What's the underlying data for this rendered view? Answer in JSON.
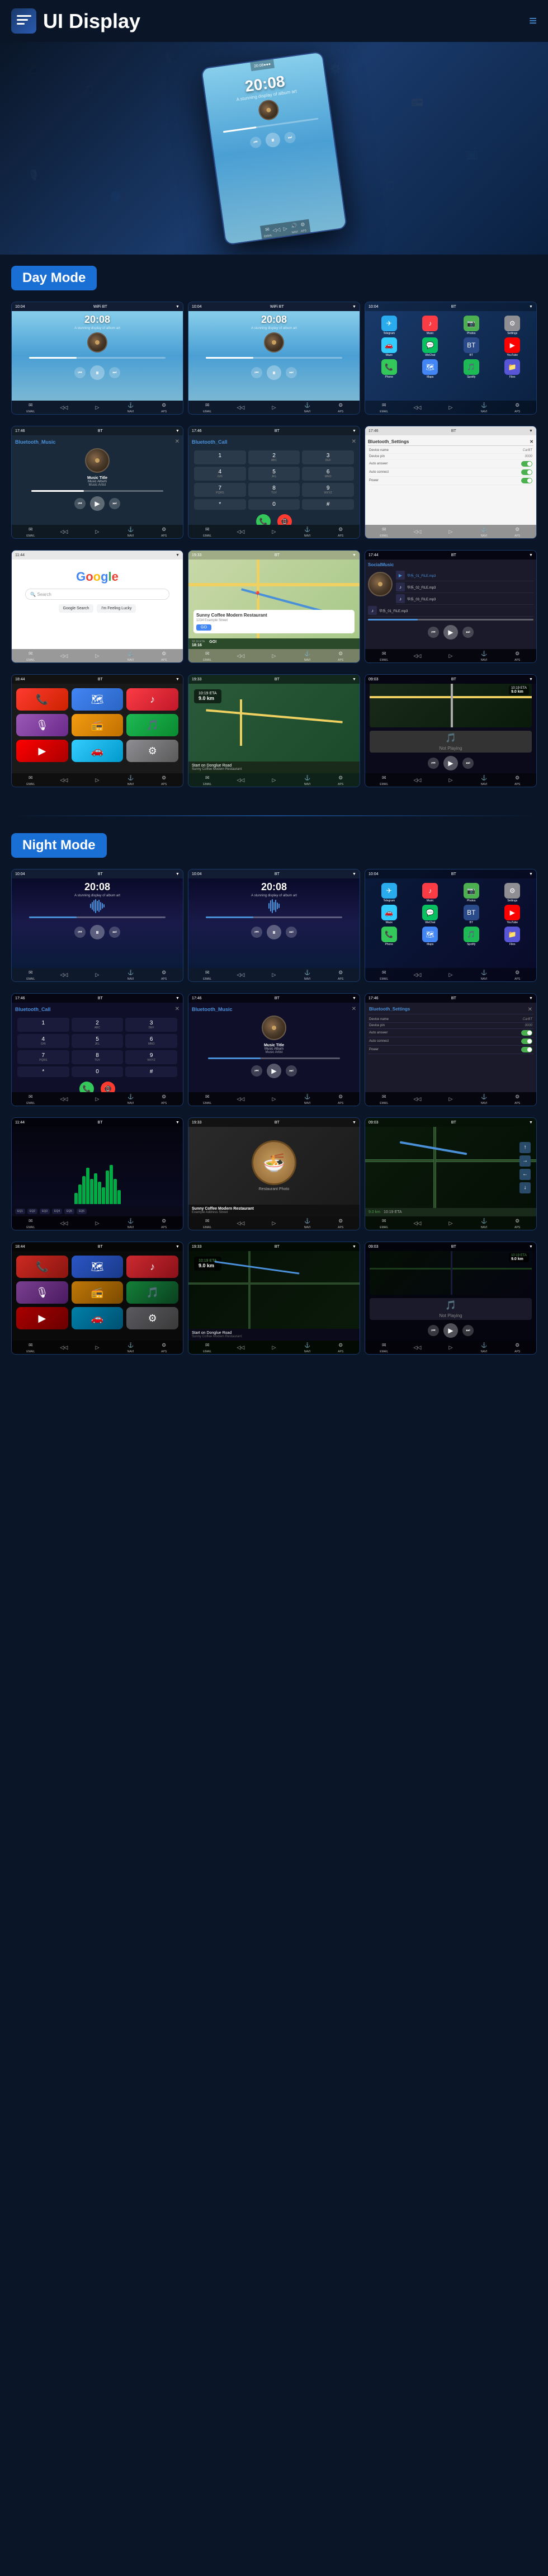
{
  "header": {
    "title": "UI Display",
    "menu_icon": "☰",
    "nav_icon": "≡"
  },
  "hero": {
    "time": "20:08",
    "subtitle": "A stunning display of album art"
  },
  "day_mode": {
    "label": "Day Mode",
    "screens": [
      {
        "type": "music_player",
        "theme": "day",
        "time": "20:08",
        "subtitle": "A stunning display of album art"
      },
      {
        "type": "music_player",
        "theme": "day",
        "time": "20:08",
        "subtitle": "A stunning display of album art"
      },
      {
        "type": "app_grid",
        "theme": "day"
      },
      {
        "type": "bluetooth_music",
        "title": "Bluetooth_Music",
        "track_title": "Music Title",
        "track_album": "Music Album",
        "track_artist": "Music Artist"
      },
      {
        "type": "bluetooth_call",
        "title": "Bluetooth_Call"
      },
      {
        "type": "bluetooth_settings",
        "title": "Bluetooth_Settings",
        "fields": [
          {
            "name": "Device name",
            "value": "CarBT"
          },
          {
            "name": "Device pin",
            "value": "0000"
          },
          {
            "name": "Auto answer",
            "value": "toggle_on"
          },
          {
            "name": "Auto connect",
            "value": "toggle_on"
          },
          {
            "name": "Power",
            "value": "toggle_on"
          }
        ]
      },
      {
        "type": "google",
        "search_placeholder": "Search"
      },
      {
        "type": "map_navigation",
        "destination": "Sunny Coffee Modern Restaurant",
        "address": "1234 Example Street"
      },
      {
        "type": "local_music",
        "title": "SocialMusic",
        "tracks": [
          {
            "name": "华乐_01_FILE.mp3",
            "active": true
          },
          {
            "name": "华乐_02_FILE.mp3",
            "active": false
          },
          {
            "name": "华乐_03_FILE.mp3",
            "active": false
          },
          {
            "name": "华乐_01_FILE.mp3",
            "active": false
          }
        ]
      },
      {
        "type": "carplay_apps",
        "apps": [
          "📞",
          "🗺️",
          "♪",
          "📱",
          "📻",
          "🎵",
          "📺",
          "🎙️",
          "⚙️"
        ]
      },
      {
        "type": "nav_detail",
        "eta": "10:19 ETA",
        "distance": "9.0 km",
        "instruction": "Start on Donglue Road",
        "poi_name": "Sunny Coffee Modern Restaurant"
      },
      {
        "type": "not_playing",
        "label": "Not Playing"
      }
    ]
  },
  "night_mode": {
    "label": "Night Mode",
    "screens": [
      {
        "type": "music_player",
        "theme": "night",
        "time": "20:08",
        "subtitle": "A stunning display of album art"
      },
      {
        "type": "music_player",
        "theme": "night",
        "time": "20:08",
        "subtitle": "A stunning display of album art"
      },
      {
        "type": "app_grid",
        "theme": "night"
      },
      {
        "type": "bluetooth_call_night",
        "title": "Bluetooth_Call"
      },
      {
        "type": "bluetooth_music_night",
        "title": "Bluetooth_Music",
        "track_title": "Music Title",
        "track_album": "Music Album",
        "track_artist": "Music Artist"
      },
      {
        "type": "bluetooth_settings_night",
        "title": "Bluetooth_Settings",
        "fields": [
          {
            "name": "Device name",
            "value": "CarBT"
          },
          {
            "name": "Device pin",
            "value": "0000"
          },
          {
            "name": "Auto answer",
            "value": "toggle_on"
          },
          {
            "name": "Auto connect",
            "value": "toggle_on"
          },
          {
            "name": "Power",
            "value": "toggle_on"
          }
        ]
      },
      {
        "type": "eq_display",
        "theme": "night"
      },
      {
        "type": "food_photo",
        "theme": "night"
      },
      {
        "type": "night_navigation"
      },
      {
        "type": "carplay_night"
      },
      {
        "type": "nav_night_detail",
        "eta": "10:19 ETA",
        "distance": "9.0 km",
        "poi_name": "Sunny Coffee Modern Restaurant"
      },
      {
        "type": "not_playing_night",
        "label": "Not Playing"
      }
    ]
  },
  "bottom_nav": {
    "items": [
      "EMAIL",
      "◀◀",
      "◀",
      "▶",
      "NAVI",
      "APS"
    ]
  }
}
